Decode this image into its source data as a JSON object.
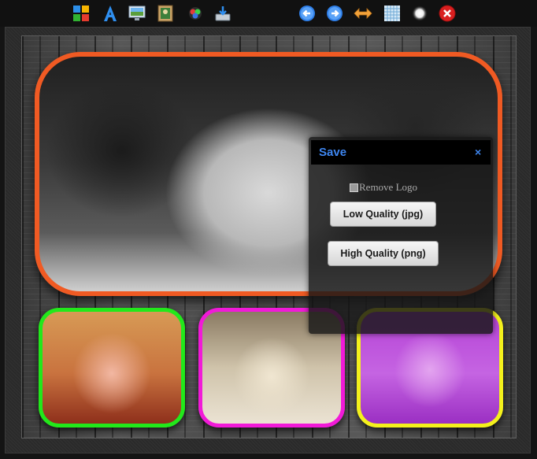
{
  "toolbar": {
    "icons": [
      {
        "name": "layout-grid-icon"
      },
      {
        "name": "text-tool-icon"
      },
      {
        "name": "background-icon"
      },
      {
        "name": "insert-photo-icon"
      },
      {
        "name": "color-effects-icon"
      },
      {
        "name": "save-download-icon"
      },
      {
        "name": "undo-arrow-icon"
      },
      {
        "name": "redo-arrow-icon"
      },
      {
        "name": "swap-arrows-icon"
      },
      {
        "name": "pattern-texture-icon"
      },
      {
        "name": "glow-brightness-icon"
      },
      {
        "name": "close-icon"
      }
    ]
  },
  "colors": {
    "main_frame": "#f05a23",
    "thumb1": "#22e81b",
    "thumb2": "#f11ad8",
    "thumb3": "#f4f11c",
    "dialog_accent": "#3e86f0"
  },
  "save_dialog": {
    "title": "Save",
    "close": "×",
    "remove_logo_label": "Remove Logo",
    "low_quality_label": "Low Quality (jpg)",
    "high_quality_label": "High Quality (png)"
  }
}
